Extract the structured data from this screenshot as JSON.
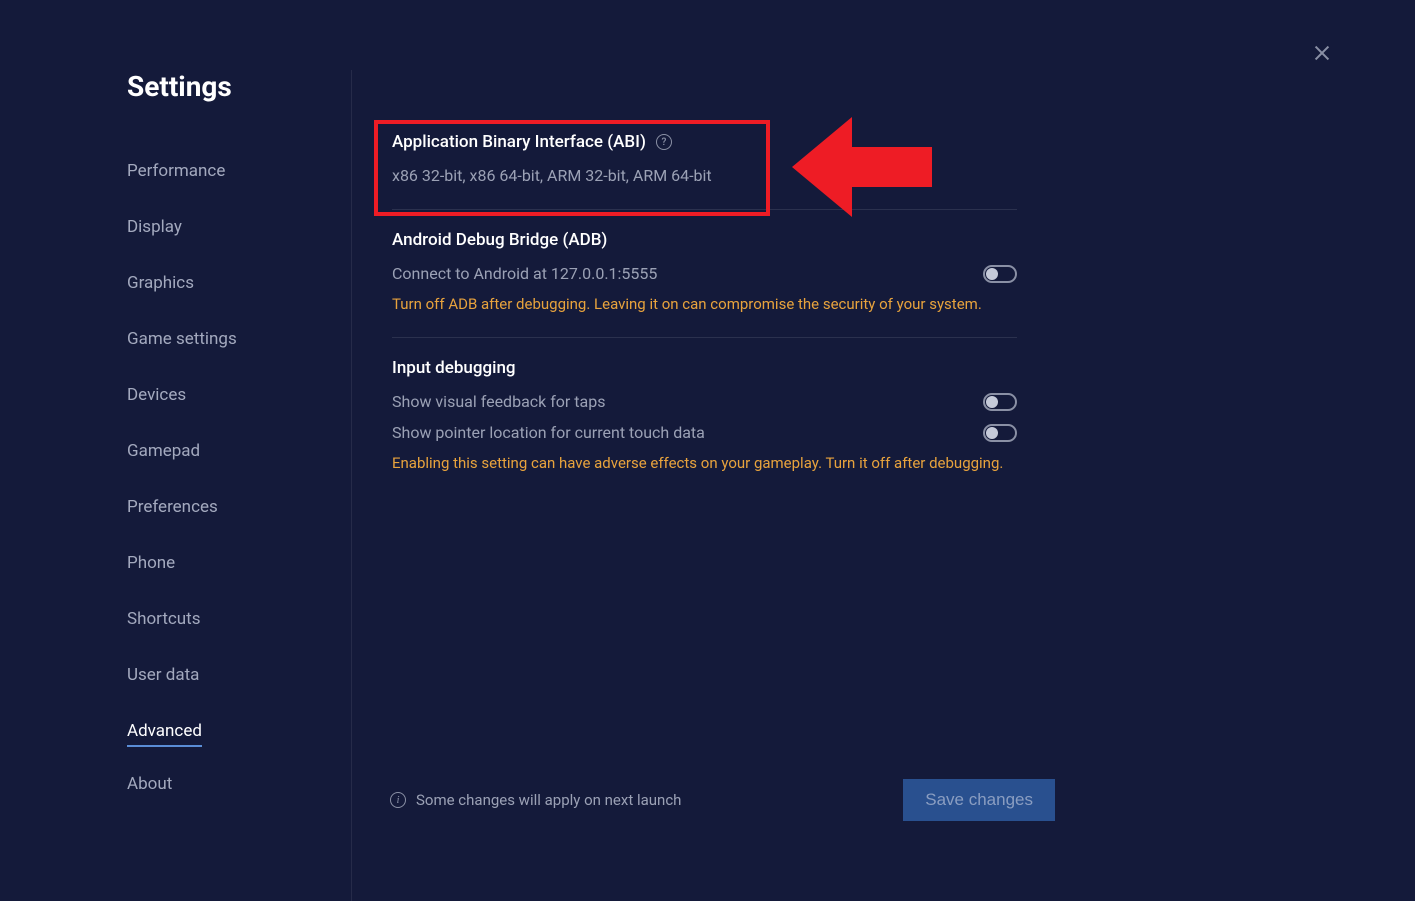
{
  "page": {
    "title": "Settings"
  },
  "sidebar": {
    "items": [
      {
        "label": "Performance",
        "id": "performance"
      },
      {
        "label": "Display",
        "id": "display"
      },
      {
        "label": "Graphics",
        "id": "graphics"
      },
      {
        "label": "Game settings",
        "id": "game-settings"
      },
      {
        "label": "Devices",
        "id": "devices"
      },
      {
        "label": "Gamepad",
        "id": "gamepad"
      },
      {
        "label": "Preferences",
        "id": "preferences"
      },
      {
        "label": "Phone",
        "id": "phone"
      },
      {
        "label": "Shortcuts",
        "id": "shortcuts"
      },
      {
        "label": "User data",
        "id": "user-data"
      },
      {
        "label": "Advanced",
        "id": "advanced",
        "active": true
      },
      {
        "label": "About",
        "id": "about"
      }
    ]
  },
  "sections": {
    "abi": {
      "title": "Application Binary Interface (ABI)",
      "value": "x86 32-bit, x86 64-bit, ARM 32-bit, ARM 64-bit"
    },
    "adb": {
      "title": "Android Debug Bridge (ADB)",
      "connect_label": "Connect to Android at 127.0.0.1:5555",
      "warning": "Turn off ADB after debugging. Leaving it on can compromise the security of your system."
    },
    "input_debug": {
      "title": "Input debugging",
      "tap_label": "Show visual feedback for taps",
      "pointer_label": "Show pointer location for current touch data",
      "warning": "Enabling this setting can have adverse effects on your gameplay. Turn it off after debugging."
    }
  },
  "footer": {
    "note": "Some changes will apply on next launch",
    "save_label": "Save changes"
  },
  "annotation": {
    "highlight_color": "#ee1c25"
  }
}
